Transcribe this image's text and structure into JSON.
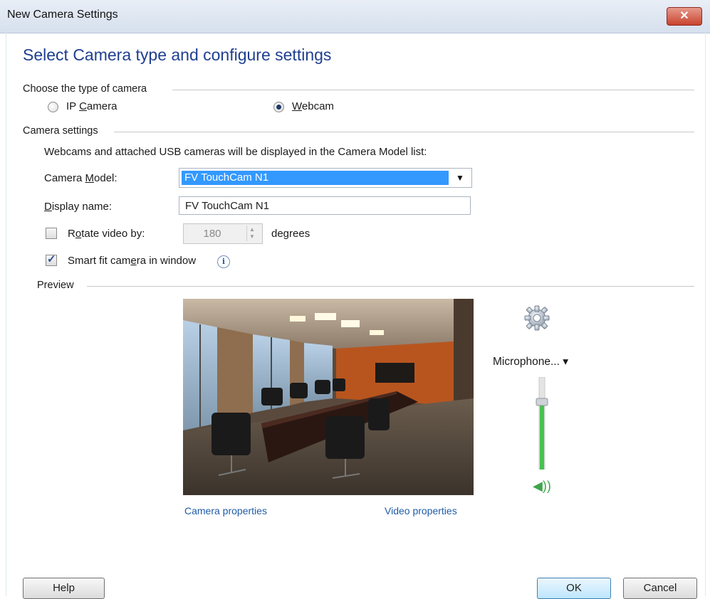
{
  "window": {
    "title": "New Camera Settings",
    "close_glyph": "✕"
  },
  "heading": "Select Camera type and configure settings",
  "camera_type": {
    "group_label": "Choose the type of camera",
    "options": [
      {
        "label_pre": "IP ",
        "label_accel": "C",
        "label_post": "amera",
        "checked": false
      },
      {
        "label_pre": "",
        "label_accel": "W",
        "label_post": "ebcam",
        "checked": true
      }
    ]
  },
  "settings": {
    "group_label": "Camera settings",
    "hint": "Webcams and attached USB cameras will be displayed in the Camera Model list:",
    "model": {
      "label_pre": "Camera ",
      "label_accel": "M",
      "label_post": "odel:",
      "value": "FV TouchCam N1"
    },
    "display_name": {
      "label_pre": "",
      "label_accel": "D",
      "label_post": "isplay name:",
      "value": "FV TouchCam N1"
    },
    "rotate": {
      "label_pre": "R",
      "label_accel": "o",
      "label_post": "tate video by:",
      "value": "180",
      "unit": "degrees",
      "checked": false
    },
    "smart_fit": {
      "label_pre": "Smart fit cam",
      "label_accel": "e",
      "label_post": "ra in window",
      "checked": true,
      "info_glyph": "i"
    }
  },
  "preview": {
    "group_label": "Preview",
    "camera_properties_link": "Camera properties",
    "video_properties_link": "Video properties",
    "microphone_label": "Microphone... ▾",
    "volume_level": 0.72,
    "speaker_glyph": "◀))"
  },
  "buttons": {
    "help": "Help",
    "ok": "OK",
    "cancel": "Cancel"
  },
  "colors": {
    "heading": "#1f3f8f",
    "selection": "#3399ff",
    "link": "#1f5ba8",
    "volume": "#46c24f"
  }
}
